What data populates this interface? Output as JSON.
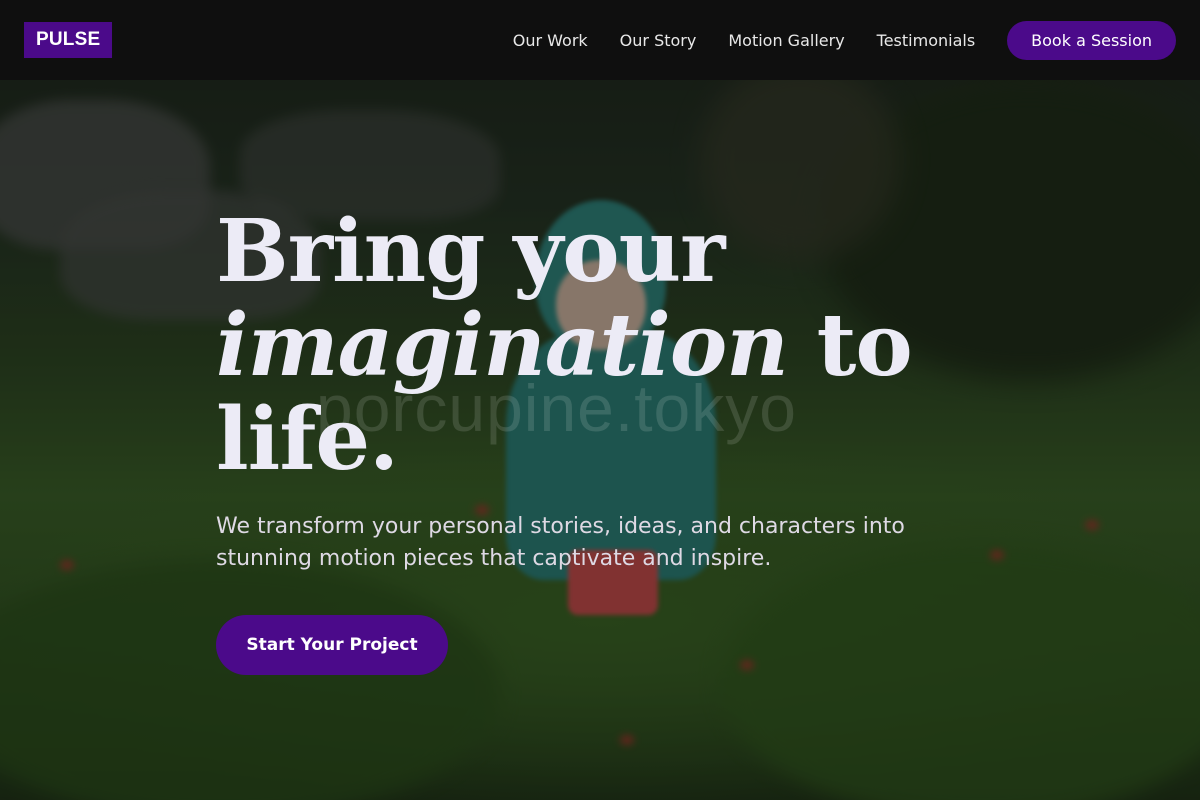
{
  "nav": {
    "logo": "PULSE",
    "links": [
      "Our Work",
      "Our Story",
      "Motion Gallery",
      "Testimonials"
    ],
    "cta": "Book a Session"
  },
  "hero": {
    "headline_line1": "Bring your",
    "headline_italic": "imagination",
    "headline_to": " to",
    "headline_line3": "life.",
    "subtext": "We transform your personal stories, ideas, and characters into stunning motion pieces that captivate and inspire.",
    "cta": "Start Your Project",
    "watermark": "porcupine.tokyo"
  },
  "colors": {
    "accent": "#4b0a8a",
    "navbar": "#0f0f0f",
    "headline": "#ecebf6"
  }
}
